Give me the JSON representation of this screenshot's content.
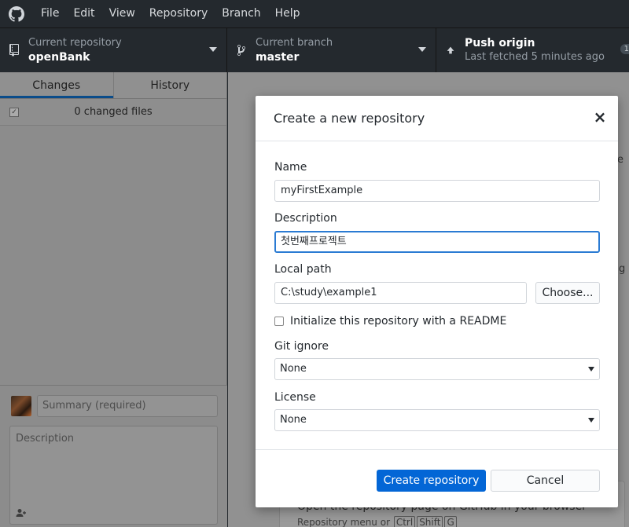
{
  "menu": [
    "File",
    "Edit",
    "View",
    "Repository",
    "Branch",
    "Help"
  ],
  "toolbar": {
    "repo_desc": "Current repository",
    "repo_name": "openBank",
    "branch_desc": "Current branch",
    "branch_name": "master",
    "push_title": "Push origin",
    "push_desc": "Last fetched 5 minutes ago",
    "push_badge": "1"
  },
  "sidebar": {
    "tabs": [
      "Changes",
      "History"
    ],
    "changed_files": "0 changed files",
    "summary_placeholder": "Summary (required)",
    "description_placeholder": "Description"
  },
  "main": {
    "peek_text_1": "e",
    "peek_text_2": "g",
    "bottom_title": "Open the repository page on GitHub in your browser",
    "bottom_hint_prefix": "Repository menu or",
    "bottom_keys": [
      "Ctrl",
      "Shift",
      "G"
    ]
  },
  "dialog": {
    "title": "Create a new repository",
    "close": "×",
    "name_label": "Name",
    "name_value": "myFirstExample",
    "description_label": "Description",
    "description_value": "첫번째프로젝트",
    "local_path_label": "Local path",
    "local_path_value": "C:\\study\\example1",
    "choose_button": "Choose...",
    "readme_label": "Initialize this repository with a README",
    "readme_checked": false,
    "gitignore_label": "Git ignore",
    "gitignore_value": "None",
    "license_label": "License",
    "license_value": "None",
    "create_button": "Create repository",
    "cancel_button": "Cancel"
  },
  "colors": {
    "primary": "#0366d6",
    "focus": "#2b7bd3",
    "toolbar_bg": "#24292e"
  }
}
